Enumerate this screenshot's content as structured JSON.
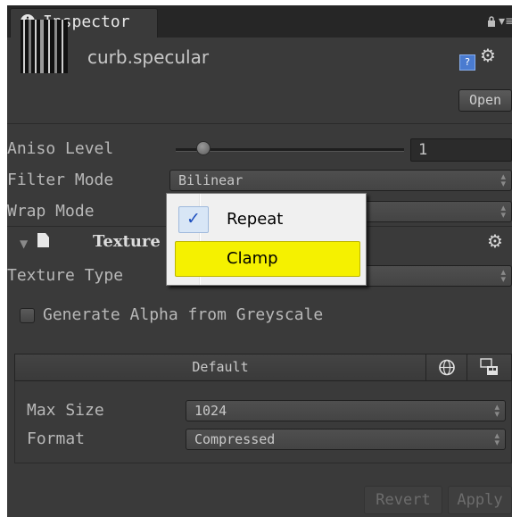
{
  "tab": {
    "title": "Inspector",
    "info_icon": "i"
  },
  "header": {
    "asset_name": "curb.specular",
    "open_label": "Open",
    "help_icon": "?"
  },
  "properties": {
    "aniso_label": "Aniso Level",
    "aniso_value": "1",
    "aniso_slider_fraction": 0.12,
    "filter_label": "Filter Mode",
    "filter_value": "Bilinear",
    "wrap_label": "Wrap Mode"
  },
  "importer": {
    "section_title": "Texture",
    "texture_type_label": "Texture Type",
    "generate_alpha_label": "Generate Alpha from Greyscale"
  },
  "platform": {
    "default_tab": "Default",
    "max_size_label": "Max Size",
    "max_size_value": "1024",
    "format_label": "Format",
    "format_value": "Compressed"
  },
  "actions": {
    "revert_label": "Revert",
    "apply_label": "Apply"
  },
  "popup": {
    "items": [
      {
        "label": "Repeat",
        "checked": true
      },
      {
        "label": "Clamp",
        "highlighted": true
      }
    ],
    "check_glyph": "✓"
  },
  "colors": {
    "panel_bg": "#3a3a3a",
    "highlight": "#f5f100",
    "check": "#1d4fbf"
  }
}
